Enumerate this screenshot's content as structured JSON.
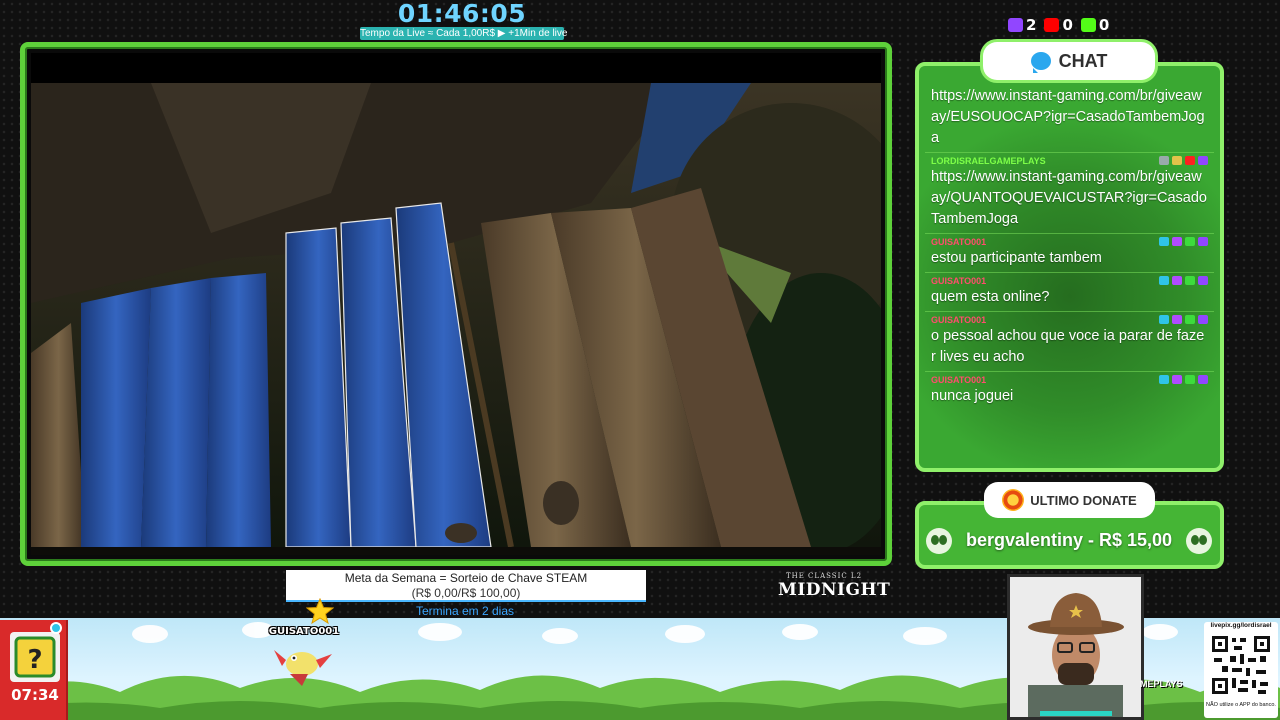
{
  "timer": {
    "value": "01:46:05",
    "subtitle": "Tempo da Live ≈ Cada 1,00R$ ▶ +1Min de live"
  },
  "platforms": [
    {
      "icon": "twitch-icon",
      "count": "2",
      "color": "#9146ff"
    },
    {
      "icon": "youtube-icon",
      "count": "0",
      "color": "#ff0000"
    },
    {
      "icon": "kick-icon",
      "count": "0",
      "color": "#53fc18"
    }
  ],
  "chat": {
    "title": "CHAT",
    "messages": [
      {
        "user": "",
        "user_color": "#7cff5a",
        "text": "https://www.instant-gaming.com/br/giveaway/EUSOUOCAP?igr=CasadoTambemJoga"
      },
      {
        "user": "LORDISRAELGAMEPLAYS",
        "user_color": "#7dff48",
        "text": "https://www.instant-gaming.com/br/giveaway/QUANTOQUEVAICUSTAR?igr=CasadoTambemJoga"
      },
      {
        "user": "GUISATO001",
        "user_color": "#ff4d6d",
        "text": "estou participante tambem"
      },
      {
        "user": "GUISATO001",
        "user_color": "#ff4d6d",
        "text": "quem esta online?"
      },
      {
        "user": "GUISATO001",
        "user_color": "#ff4d6d",
        "text": "o pessoal achou que voce ia parar de fazer lives eu acho"
      },
      {
        "user": "GUISATO001",
        "user_color": "#ff4d6d",
        "text": "nunca joguei"
      }
    ]
  },
  "donate": {
    "title": "ULTIMO DONATE",
    "text": "bergvalentiny - R$ 15,00"
  },
  "goal": {
    "title": "Meta da Semana = Sorteio de Chave STEAM",
    "amount": "(R$ 0,00/R$ 100,00)",
    "ends": "Termina em 2 dias",
    "progress": 0.0
  },
  "brand": {
    "small": "THE CLASSIC L2",
    "main": "MIDNIGHT"
  },
  "alert": {
    "username": "GUISATO001",
    "time": "07:34"
  },
  "webcam_overlay": "MEPLAYS",
  "qr": {
    "url": "livepix.gg/lordisrael",
    "footer": "NÃO utilize o APP do banco."
  }
}
